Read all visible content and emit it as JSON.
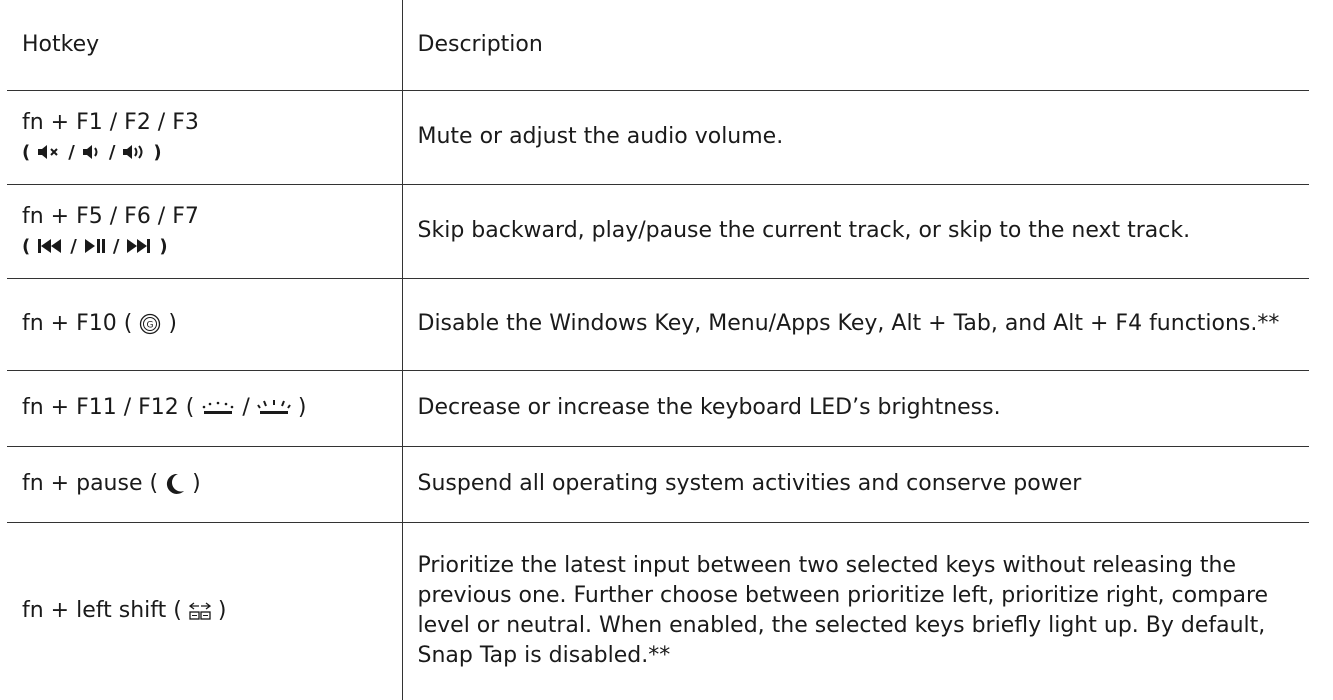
{
  "header": {
    "hotkey": "Hotkey",
    "description": "Description"
  },
  "rows": [
    {
      "keys": "fn + F1 / F2 / F3",
      "icons": [
        "mute-icon",
        "volume-down-icon",
        "volume-up-icon"
      ],
      "description": "Mute or adjust the audio volume."
    },
    {
      "keys": "fn + F5 / F6 / F7",
      "icons": [
        "previous-track-icon",
        "play-pause-icon",
        "next-track-icon"
      ],
      "description": "Skip backward, play/pause the current track, or skip to the next track."
    },
    {
      "keys": "fn + F10 (",
      "keys_end": ")",
      "icons": [
        "gaming-mode-icon"
      ],
      "description": "Disable the Windows Key, Menu/Apps Key, Alt + Tab, and Alt + F4 functions.**"
    },
    {
      "keys": "fn + F11 / F12 (",
      "keys_mid": "/",
      "keys_end": ")",
      "icons": [
        "brightness-down-icon",
        "brightness-up-icon"
      ],
      "description": "Decrease or increase the keyboard LED’s brightness."
    },
    {
      "keys": "fn + pause (",
      "keys_end": ")",
      "icons": [
        "sleep-moon-icon"
      ],
      "description": "Suspend all operating system activities and conserve power"
    },
    {
      "keys": "fn + left shift (",
      "keys_end": ")",
      "icons": [
        "snap-tap-icon"
      ],
      "description": "Prioritize the latest input between two selected keys without releasing the previous one. Further choose between prioritize left, prioritize right, compare level or neutral. When enabled, the selected keys briefly light up. By default, Snap Tap is disabled.**"
    }
  ],
  "symbols": {
    "open": "(",
    "close": ")",
    "sep": "/"
  }
}
